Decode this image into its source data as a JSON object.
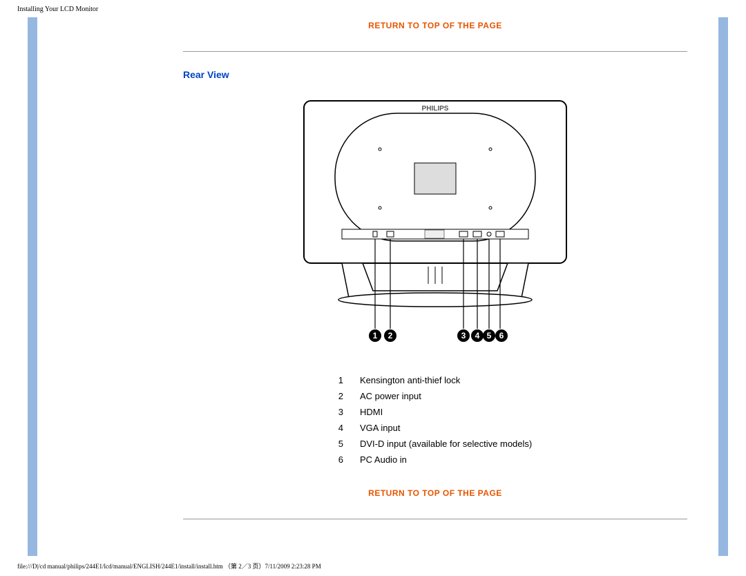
{
  "header": {
    "title": "Installing Your LCD Monitor"
  },
  "links": {
    "return_top_1": "RETURN TO TOP OF THE PAGE",
    "return_top_2": "RETURN TO TOP OF THE PAGE"
  },
  "section": {
    "rear_view_title": "Rear View"
  },
  "brand": "PHILIPS",
  "diagram": {
    "callouts": [
      "1",
      "2",
      "3",
      "4",
      "5",
      "6"
    ]
  },
  "ports": [
    {
      "num": "1",
      "label": "Kensington anti-thief lock"
    },
    {
      "num": "2",
      "label": "AC power input"
    },
    {
      "num": "3",
      "label": "HDMI"
    },
    {
      "num": "4",
      "label": "VGA input"
    },
    {
      "num": "5",
      "label": "DVI-D input (available for selective models)"
    },
    {
      "num": "6",
      "label": "PC Audio in"
    }
  ],
  "footer": {
    "path": "file:///D|/cd manual/philips/244E1/lcd/manual/ENGLISH/244E1/install/install.htm （第 2／3 页）7/11/2009 2:23:28 PM"
  }
}
